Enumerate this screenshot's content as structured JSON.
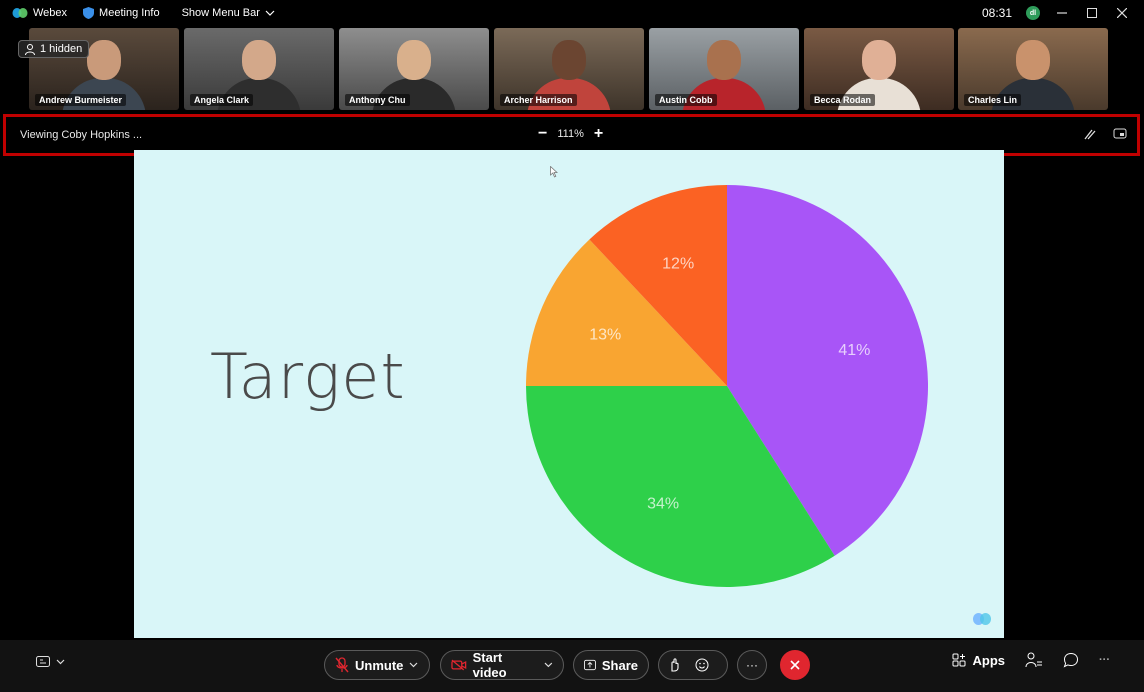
{
  "titlebar": {
    "app_name": "Webex",
    "meeting_info": "Meeting Info",
    "show_menu_bar": "Show Menu Bar",
    "time": "08:31",
    "avatar_initials": "dl"
  },
  "participants": {
    "hidden_label": "1 hidden",
    "tiles": [
      {
        "name": "Andrew Burmeister"
      },
      {
        "name": "Angela Clark"
      },
      {
        "name": "Anthony Chu"
      },
      {
        "name": "Archer Harrison"
      },
      {
        "name": "Austin Cobb"
      },
      {
        "name": "Becca Rodan"
      },
      {
        "name": "Charles Lin"
      }
    ]
  },
  "viewbar": {
    "viewing_label": "Viewing Coby Hopkins ...",
    "zoom_minus": "−",
    "zoom_level": "111%",
    "zoom_plus": "+"
  },
  "slide": {
    "title": "Target"
  },
  "chart_data": {
    "type": "pie",
    "slices": [
      {
        "label": "41%",
        "value": 41,
        "color": "#a855f7"
      },
      {
        "label": "34%",
        "value": 34,
        "color": "#2ed04a"
      },
      {
        "label": "13%",
        "value": 13,
        "color": "#f9a531"
      },
      {
        "label": "12%",
        "value": 12,
        "color": "#fb6223"
      }
    ]
  },
  "controls": {
    "unmute": "Unmute",
    "start_video": "Start video",
    "share": "Share",
    "more": "···",
    "apps": "Apps",
    "overflow": "···"
  },
  "colors": {
    "highlight_border": "#c00000",
    "end_call": "#e0262f",
    "slide_bg": "#d9f6f8"
  }
}
